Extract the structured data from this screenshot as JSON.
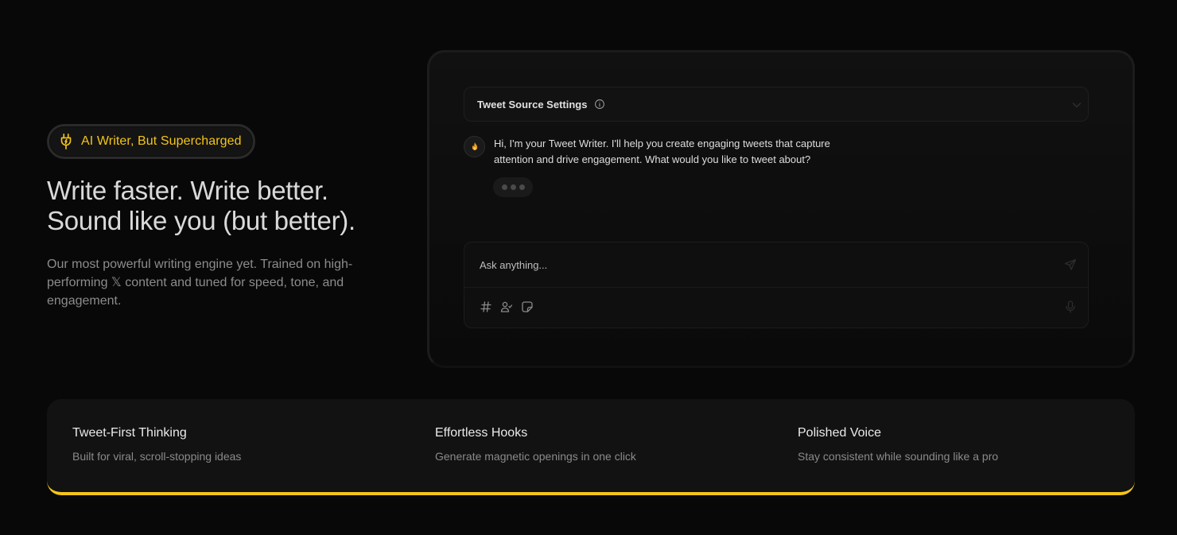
{
  "hero": {
    "badge_label": "AI Writer, But Supercharged",
    "headline_line1": "Write faster. Write better.",
    "headline_line2": "Sound like you (but better).",
    "subcopy": "Our most powerful writing engine yet. Trained on high-performing 𝕏 content and tuned for speed, tone, and engagement."
  },
  "panel": {
    "settings_title": "Tweet Source Settings",
    "bot_message": "Hi, I'm your Tweet Writer. I'll help you create engaging tweets that capture attention and drive engagement. What would you like to tweet about?",
    "input_placeholder": "Ask anything...",
    "icons": {
      "info": "info-icon",
      "chevron": "chevron-down-icon",
      "avatar": "fire-icon",
      "send": "send-icon",
      "hashtag": "hashtag-icon",
      "persona": "persona-icon",
      "sticker": "sticker-icon",
      "mic": "mic-icon"
    }
  },
  "features": [
    {
      "title": "Tweet-First Thinking",
      "description": "Built for viral, scroll-stopping ideas"
    },
    {
      "title": "Effortless Hooks",
      "description": "Generate magnetic openings in one click"
    },
    {
      "title": "Polished Voice",
      "description": "Stay consistent while sounding like a pro"
    }
  ],
  "colors": {
    "accent": "#f5c518",
    "background": "#080808",
    "card": "#121212"
  }
}
